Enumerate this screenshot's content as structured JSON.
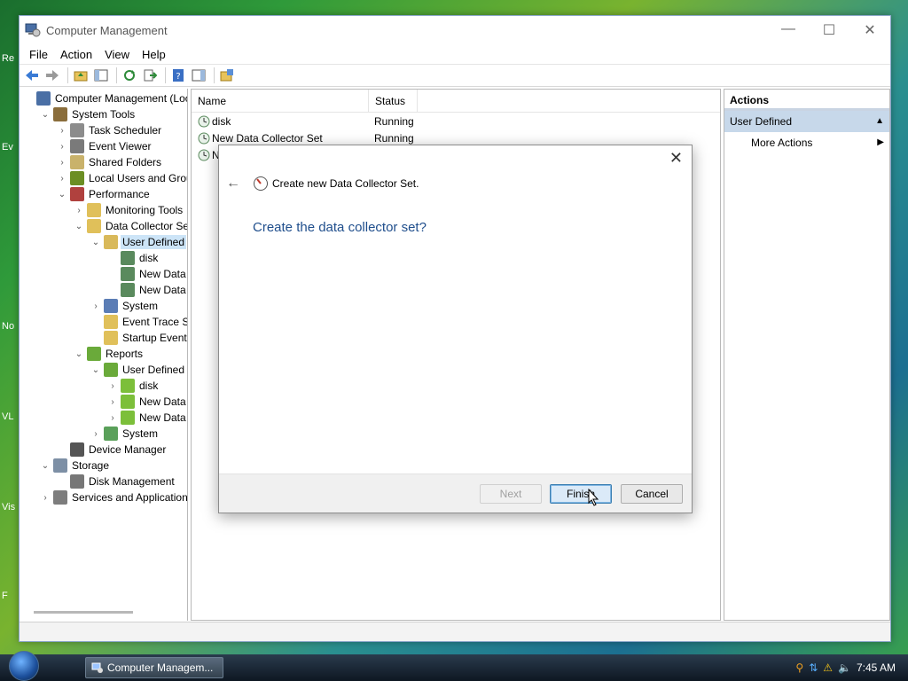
{
  "window": {
    "title": "Computer Management",
    "controls": {
      "minimize": "—",
      "maximize": "☐",
      "close": "✕"
    }
  },
  "menu": [
    "File",
    "Action",
    "View",
    "Help"
  ],
  "tree": [
    {
      "label": "Computer Management (Local",
      "level": 0,
      "toggle": "",
      "selected": false
    },
    {
      "label": "System Tools",
      "level": 1,
      "toggle": "⌄",
      "selected": false
    },
    {
      "label": "Task Scheduler",
      "level": 2,
      "toggle": "›",
      "selected": false
    },
    {
      "label": "Event Viewer",
      "level": 2,
      "toggle": "›",
      "selected": false
    },
    {
      "label": "Shared Folders",
      "level": 2,
      "toggle": "›",
      "selected": false
    },
    {
      "label": "Local Users and Groups",
      "level": 2,
      "toggle": "›",
      "selected": false
    },
    {
      "label": "Performance",
      "level": 2,
      "toggle": "⌄",
      "selected": false
    },
    {
      "label": "Monitoring Tools",
      "level": 3,
      "toggle": "›",
      "selected": false
    },
    {
      "label": "Data Collector Sets",
      "level": 3,
      "toggle": "⌄",
      "selected": false
    },
    {
      "label": "User Defined",
      "level": 4,
      "toggle": "⌄",
      "selected": true
    },
    {
      "label": "disk",
      "level": 5,
      "toggle": "",
      "selected": false
    },
    {
      "label": "New Data Co",
      "level": 5,
      "toggle": "",
      "selected": false
    },
    {
      "label": "New Data Co",
      "level": 5,
      "toggle": "",
      "selected": false
    },
    {
      "label": "System",
      "level": 4,
      "toggle": "›",
      "selected": false
    },
    {
      "label": "Event Trace Sess",
      "level": 4,
      "toggle": "",
      "selected": false
    },
    {
      "label": "Startup Event Tra",
      "level": 4,
      "toggle": "",
      "selected": false
    },
    {
      "label": "Reports",
      "level": 3,
      "toggle": "⌄",
      "selected": false
    },
    {
      "label": "User Defined",
      "level": 4,
      "toggle": "⌄",
      "selected": false
    },
    {
      "label": "disk",
      "level": 5,
      "toggle": "›",
      "selected": false
    },
    {
      "label": "New Data Co",
      "level": 5,
      "toggle": "›",
      "selected": false
    },
    {
      "label": "New Data Co",
      "level": 5,
      "toggle": "›",
      "selected": false
    },
    {
      "label": "System",
      "level": 4,
      "toggle": "›",
      "selected": false
    },
    {
      "label": "Device Manager",
      "level": 2,
      "toggle": "",
      "selected": false
    },
    {
      "label": "Storage",
      "level": 1,
      "toggle": "⌄",
      "selected": false
    },
    {
      "label": "Disk Management",
      "level": 2,
      "toggle": "",
      "selected": false
    },
    {
      "label": "Services and Applications",
      "level": 1,
      "toggle": "›",
      "selected": false
    }
  ],
  "list": {
    "columns": [
      "Name",
      "Status"
    ],
    "rows": [
      {
        "name": "disk",
        "status": "Running"
      },
      {
        "name": "New Data Collector Set",
        "status": "Running"
      },
      {
        "name": "N",
        "status": ""
      }
    ]
  },
  "actions": {
    "title": "Actions",
    "section": "User Defined",
    "items": [
      "More Actions"
    ]
  },
  "dialog": {
    "close": "✕",
    "back": "←",
    "header": "Create new Data Collector Set.",
    "prompt": "Create the data collector set?",
    "buttons": {
      "next": "Next",
      "finish": "Finish",
      "cancel": "Cancel"
    }
  },
  "taskbar": {
    "task": "Computer Managem...",
    "clock": "7:45 AM"
  },
  "desktop_hints": [
    "Re",
    "Ev",
    "No",
    "VL",
    "Vis",
    "F"
  ]
}
